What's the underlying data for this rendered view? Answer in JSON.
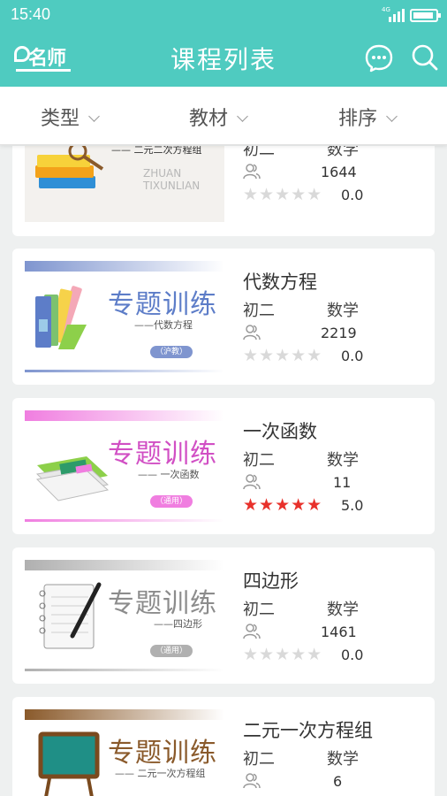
{
  "status_bar": {
    "time": "15:40",
    "network": "4G"
  },
  "app_bar": {
    "logo_text": "名师",
    "title": "课程列表"
  },
  "filters": [
    {
      "label": "类型"
    },
    {
      "label": "教材"
    },
    {
      "label": "排序"
    }
  ],
  "courses": [
    {
      "title": "",
      "grade": "初二",
      "subject": "数学",
      "learners": "1644",
      "rating": "0.0",
      "stars": "★★★★★",
      "thumb_heading": "",
      "thumb_sub": "—— 二元二次方程组",
      "thumb_letters": "ZHUAN\nTIXUNLIAN",
      "thumb_pill": "",
      "accent": "#8a9bd0"
    },
    {
      "title": "代数方程",
      "grade": "初二",
      "subject": "数学",
      "learners": "2219",
      "rating": "0.0",
      "stars": "★★★★★",
      "thumb_heading": "专题训练",
      "thumb_sub": "——代数方程",
      "thumb_pill": "（沪教）",
      "accent": "#5d7dc8"
    },
    {
      "title": "一次函数",
      "grade": "初二",
      "subject": "数学",
      "learners": "11",
      "rating": "5.0",
      "stars": "★★★★★",
      "thumb_heading": "专题训练",
      "thumb_sub": "—— 一次函数",
      "thumb_pill": "（通用）",
      "accent": "#d14fc4"
    },
    {
      "title": "四边形",
      "grade": "初二",
      "subject": "数学",
      "learners": "1461",
      "rating": "0.0",
      "stars": "★★★★★",
      "thumb_heading": "专题训练",
      "thumb_sub": "——四边形",
      "thumb_pill": "（通用）",
      "accent": "#8c8c8c"
    },
    {
      "title": "二元一次方程组",
      "grade": "初二",
      "subject": "数学",
      "learners": "6",
      "rating": "",
      "stars": "",
      "thumb_heading": "专题训练",
      "thumb_sub": "—— 二元一次方程组",
      "thumb_pill": "",
      "accent": "#8a5a2b"
    }
  ],
  "colors": {
    "primary": "#4fcbc0",
    "star_active": "#e8312b",
    "star_inactive": "#d9d9d9"
  }
}
